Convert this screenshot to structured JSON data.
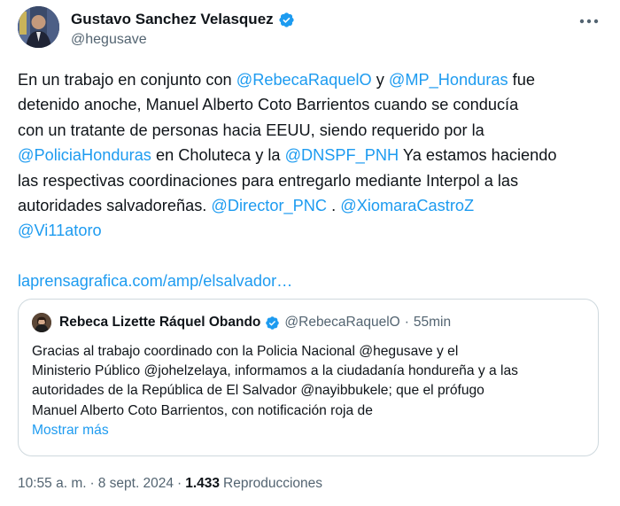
{
  "author": {
    "name": "Gustavo Sanchez Velasquez",
    "handle": "@hegusave",
    "verified_color": "#1d9bf0"
  },
  "more_icon": "more-horizontal-icon",
  "tweet": {
    "lines": [
      [
        {
          "t": "text",
          "v": "En un trabajo en conjunto con "
        },
        {
          "t": "mention",
          "v": "@RebecaRaquelO"
        },
        {
          "t": "text",
          "v": " y "
        },
        {
          "t": "mention",
          "v": "@MP_Honduras"
        },
        {
          "t": "text",
          "v": " fue"
        }
      ],
      [
        {
          "t": "text",
          "v": "detenido anoche, Manuel Alberto Coto Barrientos cuando se conducía"
        }
      ],
      [
        {
          "t": "text",
          "v": "con un tratante de personas hacia EEUU, siendo requerido por la"
        }
      ],
      [
        {
          "t": "mention",
          "v": "@PoliciaHonduras"
        },
        {
          "t": "text",
          "v": " en Choluteca y la "
        },
        {
          "t": "mention",
          "v": "@DNSPF_PNH"
        },
        {
          "t": "text",
          "v": " Ya estamos haciendo"
        }
      ],
      [
        {
          "t": "text",
          "v": "las respectivas coordinaciones para entregarlo mediante Interpol a las"
        }
      ],
      [
        {
          "t": "text",
          "v": "autoridades salvadoreñas. "
        },
        {
          "t": "mention",
          "v": "@Director_PNC"
        },
        {
          "t": "text",
          "v": " . "
        },
        {
          "t": "mention",
          "v": "@XiomaraCastroZ"
        }
      ],
      [
        {
          "t": "mention",
          "v": "@Vi11atoro"
        }
      ]
    ],
    "link": "laprensagrafica.com/amp/elsalvador…"
  },
  "quote": {
    "name": "Rebeca Lizette Ráquel Obando",
    "handle": "@RebecaRaquelO",
    "separator": "·",
    "time": "55min",
    "lines": [
      "Gracias al trabajo coordinado con la Policia Nacional @hegusave y el",
      "Ministerio Público @johelzelaya, informamos a la ciudadanía hondureña y a las",
      "autoridades de la República de El Salvador @nayibbukele; que el prófugo",
      "Manuel Alberto Coto Barrientos, con notificación roja de"
    ],
    "show_more": "Mostrar más"
  },
  "meta": {
    "time": "10:55 a. m.",
    "sep1": "·",
    "date": "8 sept. 2024",
    "sep2": "·",
    "views": "1.433",
    "views_label": "Reproducciones"
  }
}
